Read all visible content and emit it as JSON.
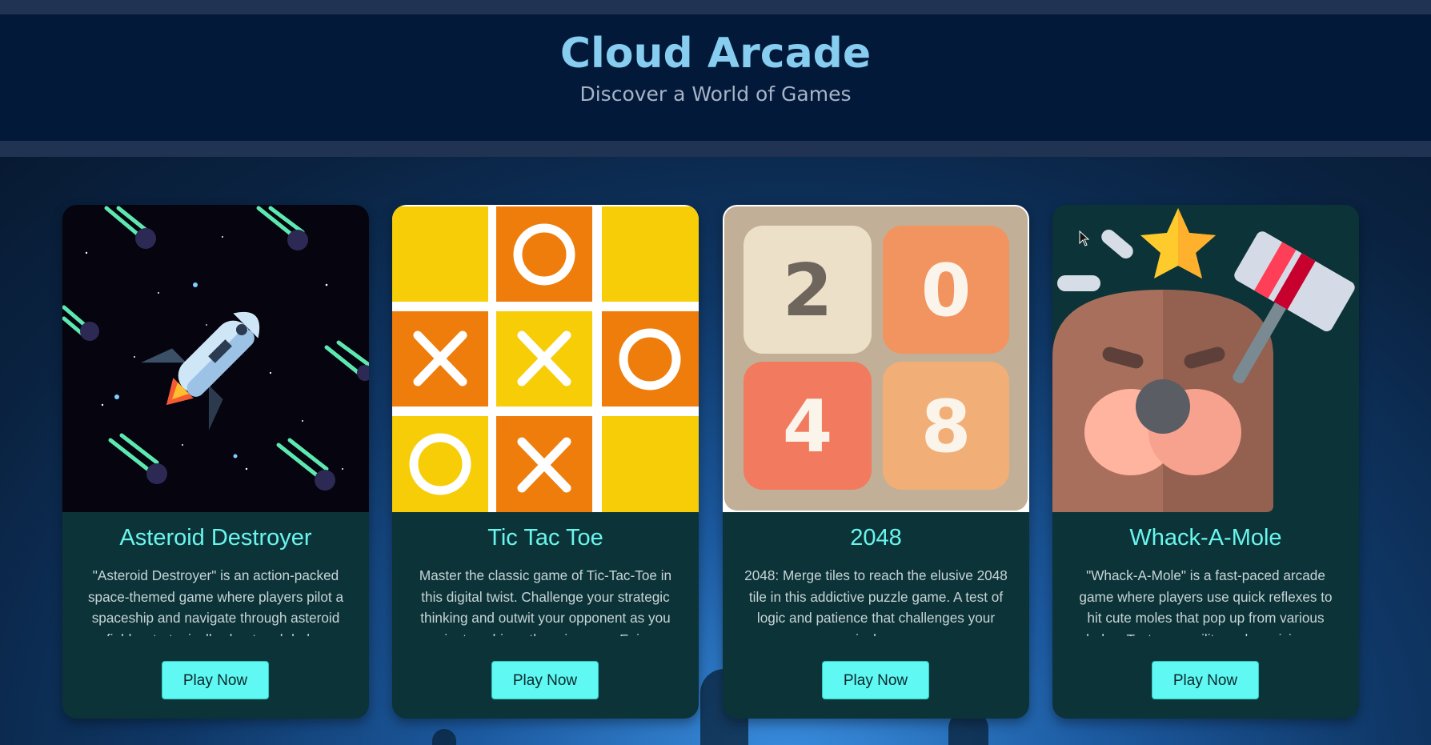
{
  "header": {
    "title": "Cloud Arcade",
    "subtitle": "Discover a World of Games"
  },
  "games": [
    {
      "title": "Asteroid Destroyer",
      "description": "\"Asteroid Destroyer\" is an action-packed space-themed game where players pilot a spaceship and navigate through asteroid fields, strategically shoot and dodge",
      "button": "Play Now",
      "image_icon": "rocket-asteroids-icon"
    },
    {
      "title": "Tic Tac Toe",
      "description": "Master the classic game of Tic-Tac-Toe in this digital twist. Challenge your strategic thinking and outwit your opponent as you aim to achieve three in a row. Enjoy",
      "button": "Play Now",
      "image_icon": "tic-tac-toe-board-icon"
    },
    {
      "title": "2048",
      "description": "2048: Merge tiles to reach the elusive 2048 tile in this addictive puzzle game. A test of logic and patience that challenges your numerical prowess.",
      "button": "Play Now",
      "image_icon": "2048-tiles-icon",
      "tiles": [
        "2",
        "0",
        "4",
        "8"
      ]
    },
    {
      "title": "Whack-A-Mole",
      "description": "\"Whack-A-Mole\" is a fast-paced arcade game where players use quick reflexes to hit cute moles that pop up from various holes. Test your agility and precision as",
      "button": "Play Now",
      "image_icon": "mole-hammer-icon"
    }
  ],
  "colors": {
    "accent": "#69f5ee",
    "button": "#5ff8f2",
    "header_bg": "#02193a",
    "title": "#86cdf0"
  }
}
